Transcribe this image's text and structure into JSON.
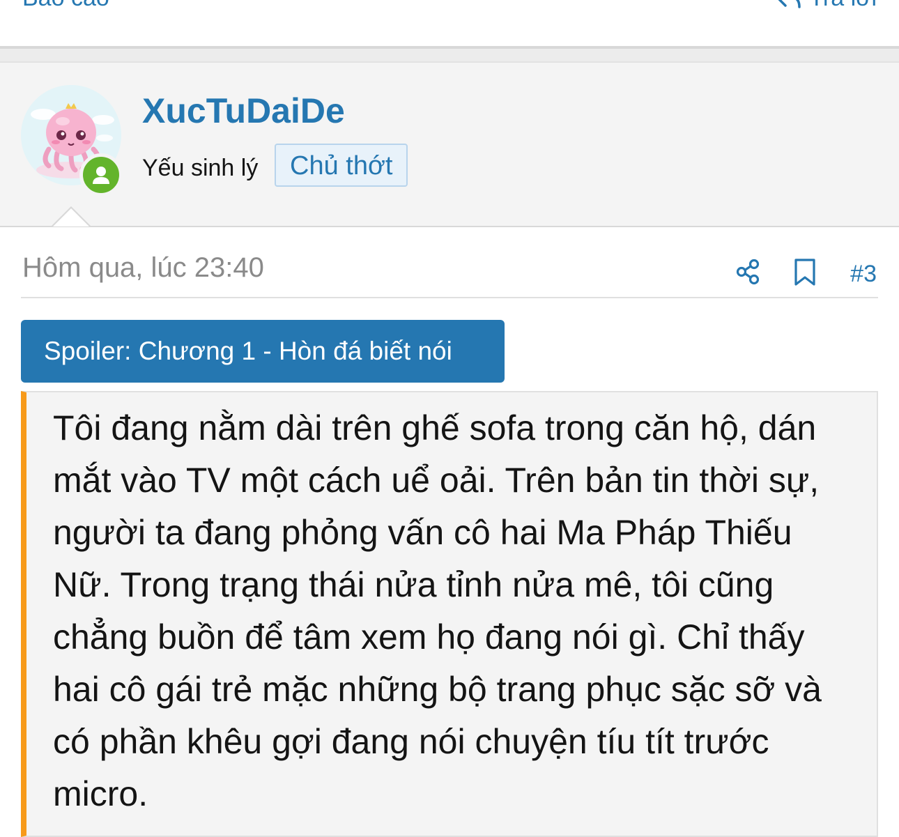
{
  "prev_post": {
    "report_label": "Báo cáo",
    "reply_label": "Trả lời"
  },
  "user": {
    "name": "XucTuDaiDe",
    "title": "Yếu sinh lý",
    "badge": "Chủ thớt"
  },
  "post": {
    "date": "Hôm qua, lúc 23:40",
    "number": "#3",
    "share_icon": "share-icon",
    "bookmark_icon": "bookmark-icon"
  },
  "spoiler": {
    "button_label": "Spoiler: Chương 1 - Hòn đá biết nói",
    "text": "Tôi đang nằm dài trên ghế sofa trong căn hộ, dán mắt vào TV một cách uể oải. Trên bản tin thời sự, người ta đang phỏng vấn cô hai Ma Pháp Thiếu Nữ. Trong trạng thái nửa tỉnh nửa mê, tôi cũng chẳng buồn để tâm xem họ đang nói gì. Chỉ thấy hai cô gái trẻ mặc những bộ trang phục sặc sỡ và có phần khêu gợi đang nói chuyện tíu tít trước micro."
  },
  "colors": {
    "accent": "#2577b1",
    "online": "#63b42b",
    "spoiler_bar": "#f79a1a",
    "muted": "#8a8a8a"
  }
}
